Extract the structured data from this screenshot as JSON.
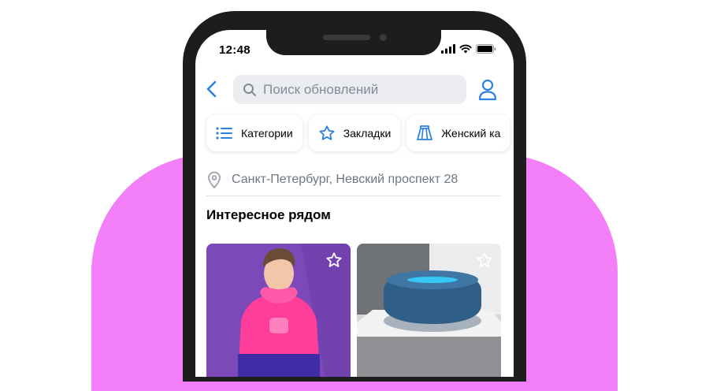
{
  "status_bar": {
    "time": "12:48"
  },
  "search": {
    "placeholder": "Поиск обновлений"
  },
  "chips": [
    {
      "label": "Категории",
      "icon": "list-icon"
    },
    {
      "label": "Закладки",
      "icon": "star-icon"
    },
    {
      "label": "Женский ка",
      "icon": "skirt-icon"
    }
  ],
  "location": {
    "text": "Санкт-Петербург, Невский проспект 28",
    "icon": "location-pin-icon"
  },
  "section": {
    "title": "Интересное рядом"
  },
  "cards": [
    {
      "name": "hoodie-product",
      "icon": "favorite-star-icon"
    },
    {
      "name": "smart-speaker-product",
      "icon": "favorite-star-icon"
    }
  ],
  "colors": {
    "accent": "#2d81e0",
    "blob": "#f27ff7",
    "phone": "#1d1d1f",
    "secondary_text": "#6d7885"
  }
}
